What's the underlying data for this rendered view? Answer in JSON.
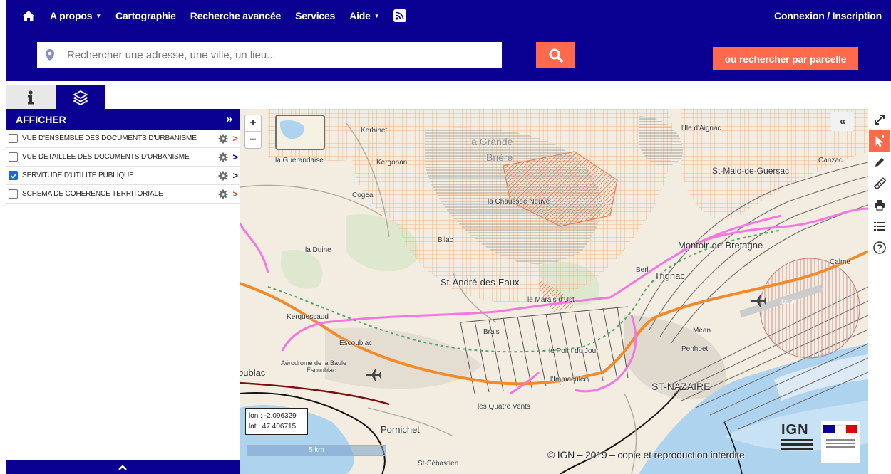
{
  "header": {
    "nav": [
      {
        "label": "A propos",
        "has_caret": true
      },
      {
        "label": "Cartographie",
        "has_caret": false
      },
      {
        "label": "Recherche avancée",
        "has_caret": false
      },
      {
        "label": "Services",
        "has_caret": false
      },
      {
        "label": "Aide",
        "has_caret": true
      }
    ],
    "login_label": "Connexion / Inscription",
    "search_placeholder": "Rechercher une adresse, une ville, un lieu...",
    "parcel_button_label": "ou rechercher par parcelle",
    "colors": {
      "brand": "#0a0092",
      "accent": "#ff6a4d"
    }
  },
  "panel": {
    "title": "AFFICHER",
    "layers": [
      {
        "label": "VUE D'ENSEMBLE DES DOCUMENTS D'URBANISME",
        "checked": false,
        "arrow_color": "#e8443a"
      },
      {
        "label": "VUE DETAILLEE DES DOCUMENTS D'URBANISME",
        "checked": false,
        "arrow_color": "#0a0092"
      },
      {
        "label": "SERVITUDE D'UTILITE PUBLIQUE",
        "checked": true,
        "arrow_color": "#0a0092"
      },
      {
        "label": "SCHEMA DE COHERENCE TERRITORIALE",
        "checked": false,
        "arrow_color": "#e8443a"
      }
    ]
  },
  "map": {
    "places": {
      "kerhinet": "Kerhinet",
      "lile_aignac": "l'Ile d'Aignac",
      "la_grande": "la Grande",
      "briere": "Brière",
      "la_guerandaise": "la Guérandaise",
      "kergonan": "Kergonan",
      "canzac": "Canzac",
      "st_malo": "St-Malo-de-Guersac",
      "cogea": "Cogea",
      "chaussee": "la Chaussée Neuve",
      "bilac": "Bilac",
      "montoir": "Montoir-de-Bretagne",
      "la_duine": "la Duine",
      "berl": "Berl",
      "trignac": "Trignac",
      "calme": "Calme",
      "st_andre": "St-André-des-Eaux",
      "marais": "le Marais d'Ust",
      "d100": "D100",
      "kerquessaud": "Kerquessaud",
      "brais": "Brais",
      "mean": "Méan",
      "escoublac": "Escoublac",
      "point_du_jour": "le Point du Jour",
      "penhoet": "Penhoet",
      "aerodrome": "Aérodrome de la Baule",
      "escoublac2": "Escoublac",
      "oublac": "oublac",
      "immaculee": "l'Immaculée",
      "st_nazaire": "ST-NAZAIRE",
      "quatre_vents": "les Quatre Vents",
      "pornichet": "Pornichet",
      "st_sebastien": "St-Sébastien"
    },
    "coords": {
      "lon_label": "lon : -2.096329",
      "lat_label": "lat : 47.406715"
    },
    "scale_label": "5 km",
    "copyright": "© IGN – 2019 – copie et reproduction interdite",
    "ign_label": "IGN"
  },
  "toolbar": {
    "tools": [
      "fullscreen-icon",
      "info-cursor-icon",
      "pencil-icon",
      "ruler-icon",
      "print-icon",
      "list-icon",
      "help-icon"
    ],
    "active_tool": "info-cursor-icon"
  }
}
